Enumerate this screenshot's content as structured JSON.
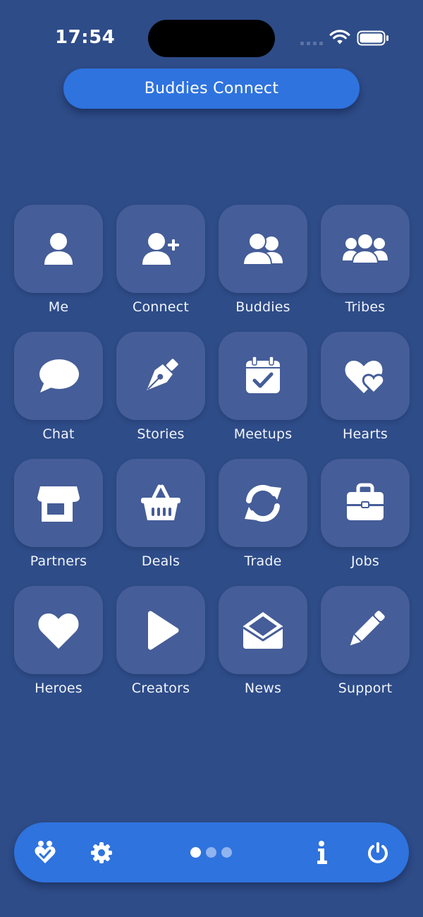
{
  "status_bar": {
    "time": "17:54"
  },
  "header": {
    "title": "Buddies Connect"
  },
  "grid": {
    "items": [
      {
        "label": "Me",
        "icon": "user-icon"
      },
      {
        "label": "Connect",
        "icon": "user-plus-icon"
      },
      {
        "label": "Buddies",
        "icon": "user-group-icon"
      },
      {
        "label": "Tribes",
        "icon": "users-icon"
      },
      {
        "label": "Chat",
        "icon": "chat-bubble-icon"
      },
      {
        "label": "Stories",
        "icon": "pen-nib-icon"
      },
      {
        "label": "Meetups",
        "icon": "calendar-check-icon"
      },
      {
        "label": "Hearts",
        "icon": "hearts-icon"
      },
      {
        "label": "Partners",
        "icon": "shop-icon"
      },
      {
        "label": "Deals",
        "icon": "basket-icon"
      },
      {
        "label": "Trade",
        "icon": "exchange-icon"
      },
      {
        "label": "Jobs",
        "icon": "briefcase-icon"
      },
      {
        "label": "Heroes",
        "icon": "heart-icon"
      },
      {
        "label": "Creators",
        "icon": "play-icon"
      },
      {
        "label": "News",
        "icon": "envelope-open-icon"
      },
      {
        "label": "Support",
        "icon": "pencil-icon"
      }
    ]
  },
  "bottom_bar": {
    "left_icons": [
      "hand-holding-heart-icon",
      "gear-icon"
    ],
    "right_icons": [
      "info-icon",
      "power-icon"
    ],
    "page_count": 3,
    "active_page": 1
  },
  "colors": {
    "background": "#2e4c88",
    "tile": "#455d98",
    "accent": "#2f73de",
    "text": "#ffffff"
  }
}
